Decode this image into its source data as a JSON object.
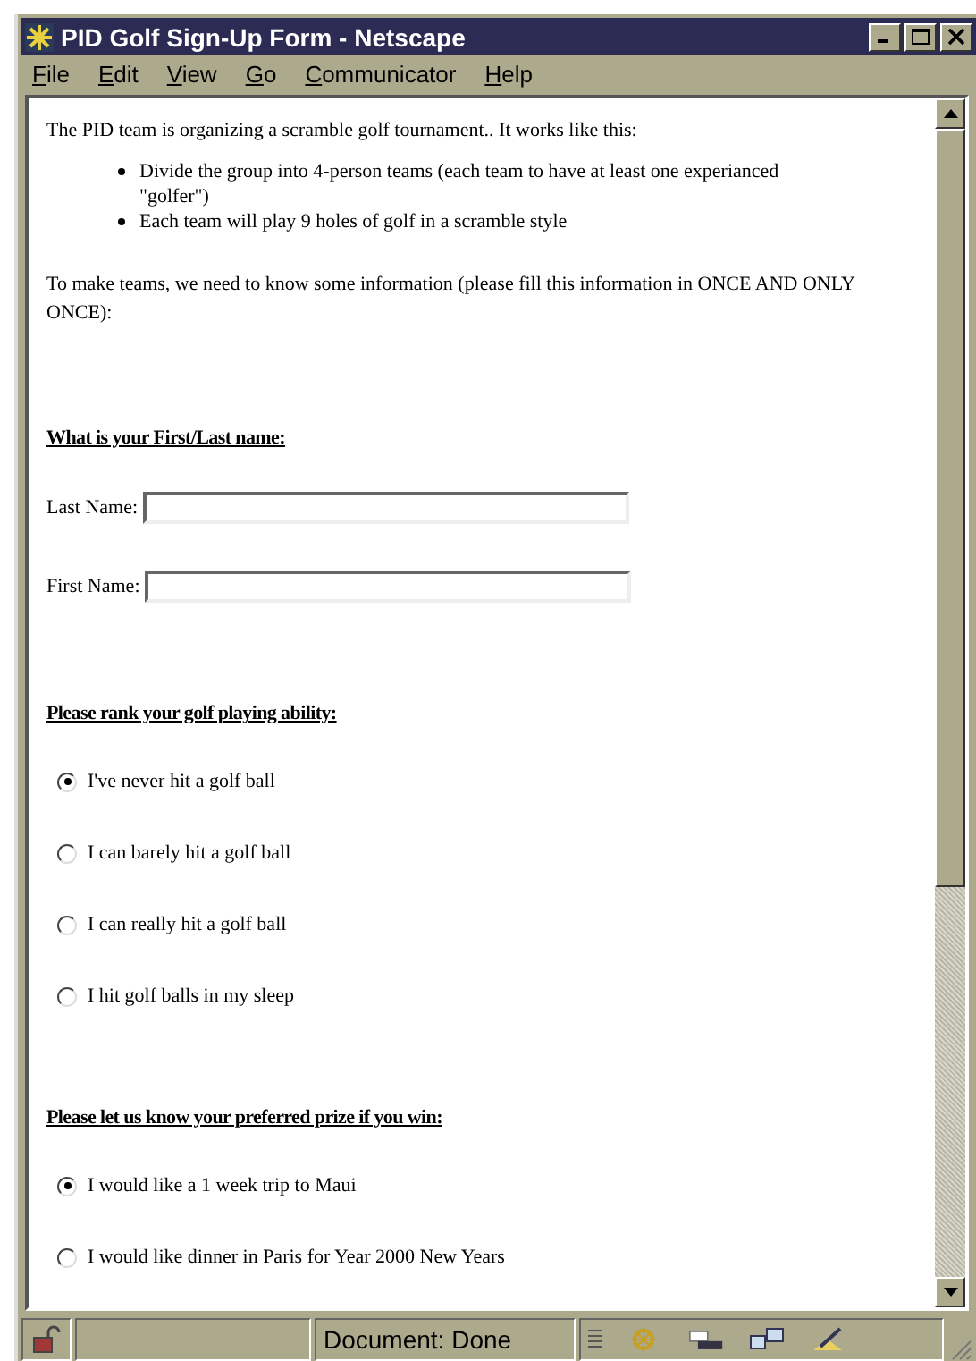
{
  "window": {
    "title": "PID Golf Sign-Up Form - Netscape"
  },
  "menu": [
    "File",
    "Edit",
    "View",
    "Go",
    "Communicator",
    "Help"
  ],
  "intro": "The PID team is organizing a scramble golf tournament.. It works like this:",
  "bullets": [
    "Divide the group into 4-person teams (each team to have at least one experianced \"golfer\")",
    "Each team will play 9 holes of golf in a scramble style"
  ],
  "note": "To make teams, we need to know some information (please fill this information in ONCE AND ONLY ONCE):",
  "sections": [
    {
      "kind": "fields",
      "heading": "What is your First/Last name:",
      "fields": [
        {
          "label": "Last Name:"
        },
        {
          "label": "First Name:"
        }
      ]
    },
    {
      "kind": "radios",
      "heading": "Please rank your golf playing ability:",
      "options": [
        {
          "label": "I've never hit a golf ball",
          "selected": true
        },
        {
          "label": "I can barely hit a golf ball",
          "selected": false
        },
        {
          "label": "I can really hit a golf ball",
          "selected": false
        },
        {
          "label": "I hit golf balls in my sleep",
          "selected": false
        }
      ]
    },
    {
      "kind": "radios",
      "heading": "Please let us know your preferred prize if you win:",
      "options": [
        {
          "label": "I would like a 1 week trip to Maui",
          "selected": true
        },
        {
          "label": "I would like dinner in Paris for Year 2000 New Years",
          "selected": false
        }
      ]
    }
  ],
  "status_bar": {
    "text": "Document: Done"
  }
}
